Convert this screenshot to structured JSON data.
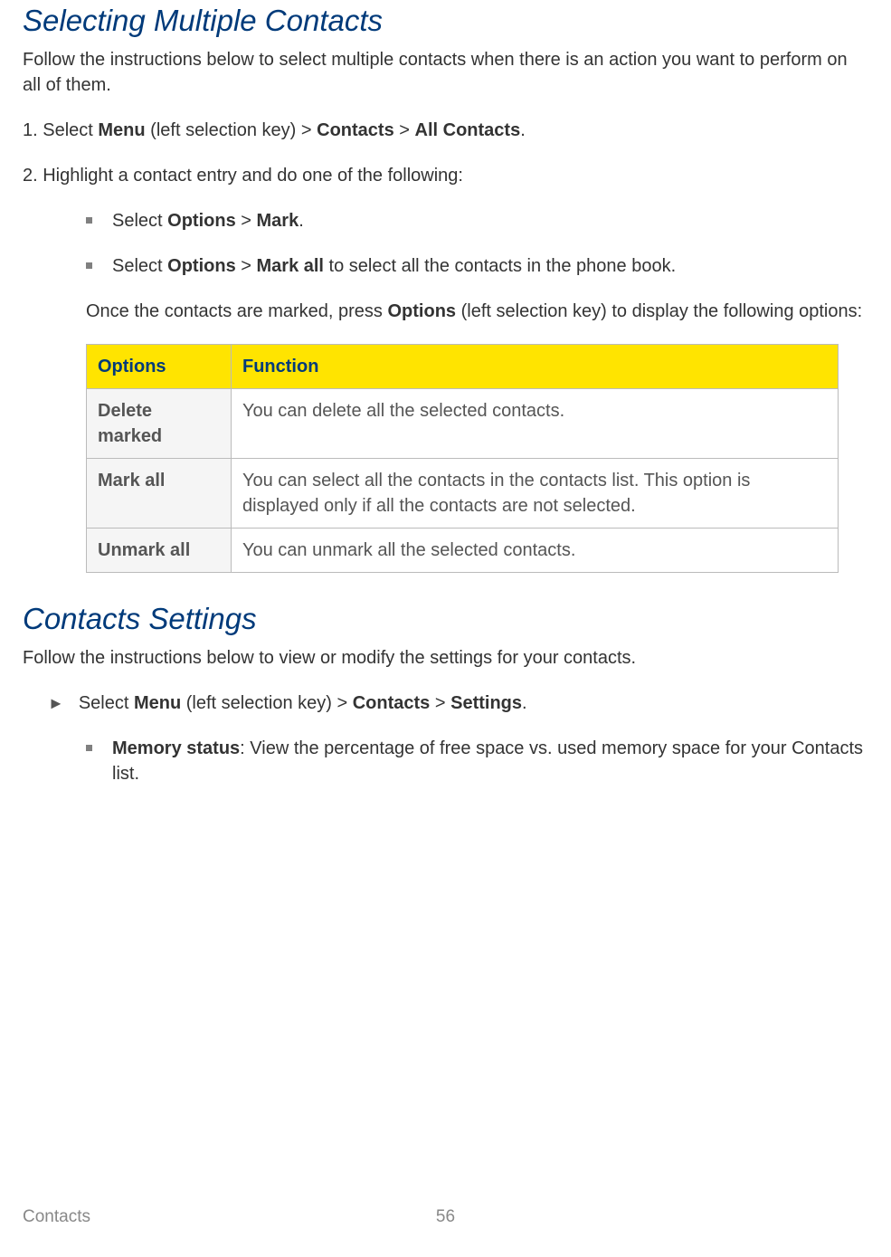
{
  "section1": {
    "heading": "Selecting Multiple Contacts",
    "intro": "Follow the instructions below to select multiple contacts when there is an action you want to perform on all of them.",
    "step1_prefix": "1. Select ",
    "step1_menu": "Menu",
    "step1_aft_menu": " (left selection key) > ",
    "step1_contacts": "Contacts",
    "step1_gt2": " > ",
    "step1_all": "All Contacts",
    "step1_period": ".",
    "step2": "2. Highlight a contact entry and do one of the following:",
    "bullet1_pre": "Select ",
    "bullet1_opt": "Options",
    "bullet1_gt": " > ",
    "bullet1_mark": "Mark",
    "bullet1_period": ".",
    "bullet2_pre": "Select ",
    "bullet2_opt": "Options",
    "bullet2_gt": " > ",
    "bullet2_markall": "Mark all",
    "bullet2_rest": " to select all the contacts in the phone book.",
    "once_pre": "Once the contacts are marked, press ",
    "once_opt": "Options",
    "once_rest": " (left selection key) to display the following options:",
    "table": {
      "h1": "Options",
      "h2": "Function",
      "r1o": "Delete marked",
      "r1f": "You can delete all the selected contacts.",
      "r2o": "Mark all",
      "r2f": "You can select all the contacts in the contacts list. This option is displayed only if all the contacts are not selected.",
      "r3o": "Unmark all",
      "r3f": "You can unmark all the selected contacts."
    }
  },
  "section2": {
    "heading": "Contacts Settings",
    "intro": "Follow the instructions below to view or modify the settings for your contacts.",
    "arrow_pre": "Select ",
    "arrow_menu": "Menu",
    "arrow_aft_menu": " (left selection key) > ",
    "arrow_contacts": "Contacts",
    "arrow_gt2": " > ",
    "arrow_settings": "Settings",
    "arrow_period": ".",
    "mem_label": "Memory status",
    "mem_rest": ": View the percentage of free space vs. used memory space for your Contacts list."
  },
  "footer": {
    "left": "Contacts",
    "page": "56"
  },
  "glyphs": {
    "arrow": "►"
  }
}
